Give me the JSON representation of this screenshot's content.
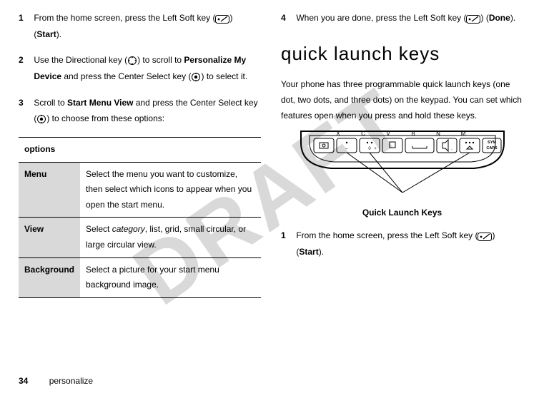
{
  "watermark": "DRAFT",
  "left": {
    "step1": {
      "num": "1",
      "text_a": "From the home screen, press the Left Soft key (",
      "text_b": ") (",
      "start": "Start",
      "text_c": ")."
    },
    "step2": {
      "num": "2",
      "text_a": "Use the Directional key (",
      "text_b": ") to scroll to ",
      "pmd": "Personalize My Device",
      "text_c": " and press the Center Select key (",
      "text_d": ") to select it."
    },
    "step3": {
      "num": "3",
      "text_a": "Scroll to ",
      "smv": "Start Menu View",
      "text_b": " and press the Center Select key (",
      "text_c": ") to choose from these options:"
    },
    "table": {
      "header": "options",
      "rows": [
        {
          "label": "Menu",
          "desc": "Select the menu you want to customize, then select which icons to appear when you open the start menu."
        },
        {
          "label": "View",
          "desc_a": "Select ",
          "desc_em": "category",
          "desc_b": ", list, grid, small circular, or large circular view."
        },
        {
          "label": "Background",
          "desc": "Select a picture for your start menu background image."
        }
      ]
    }
  },
  "right": {
    "step4": {
      "num": "4",
      "text_a": "When you are done, press the Left Soft key (",
      "text_b": ") (",
      "done": "Done",
      "text_c": ")."
    },
    "heading": "quick launch keys",
    "intro": "Your phone has three programmable quick launch keys (one dot, two dots, and three dots) on the keypad. You can set which features open when you press and hold these keys.",
    "qlk_caption": "Quick Launch Keys",
    "step1": {
      "num": "1",
      "text_a": "From the home screen, press the Left Soft key (",
      "text_b": ") (",
      "start": "Start",
      "text_c": ")."
    }
  },
  "footer": {
    "page": "34",
    "section": "personalize"
  }
}
